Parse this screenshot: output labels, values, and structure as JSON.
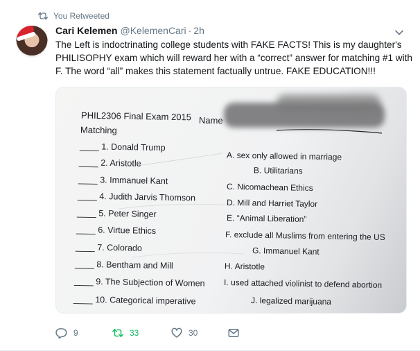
{
  "retweet_context": {
    "label": "You Retweeted"
  },
  "tweet": {
    "author_name": "Cari Kelemen",
    "author_handle": "@KelemenCari",
    "separator": "·",
    "timestamp": "2h",
    "text": "The Left is indoctrinating college students with FAKE FACTS! This is my daughter's PHILISOPHY exam which will reward her with a “correct” answer for matching #1 with F. The word “all” makes this statement factually untrue. FAKE EDUCATION!!!",
    "reply_count": "9",
    "retweet_count": "33",
    "like_count": "30"
  },
  "exam": {
    "heading": "PHIL2306 Final Exam 2015",
    "name_label": "Name",
    "section": "Matching",
    "left_items": [
      "1. Donald Trump",
      "2. Aristotle",
      "3. Immanuel Kant",
      "4. Judith Jarvis Thomson",
      "5. Peter Singer",
      "6. Virtue Ethics",
      "7. Colorado",
      "8. Bentham and Mill",
      "9. The Subjection of Women",
      "10. Categorical imperative"
    ],
    "right_items": [
      "A. sex only allowed in marriage",
      "B. Utilitarians",
      "C. Nicomachean Ethics",
      "D. Mill and Harriet Taylor",
      "E. “Animal Liberation”",
      "F. exclude all Muslims from entering the US",
      "G. Immanuel Kant",
      "H. Aristotle",
      "I. used attached violinist to defend abortion",
      "J. legalized marijuana"
    ]
  },
  "colors": {
    "secondary_text": "#657786",
    "retweet_active": "#17bf63",
    "primary_text": "#14171a"
  }
}
